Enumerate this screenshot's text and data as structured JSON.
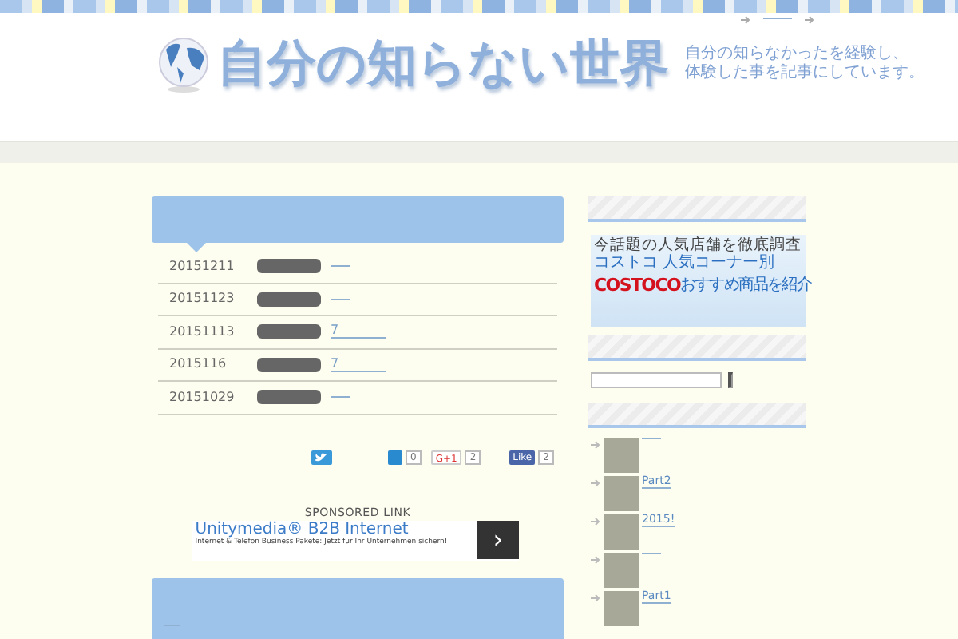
{
  "header": {
    "site_title": "自分の知らない世界",
    "tagline": [
      "自分の知らなかったを経験し、",
      "体験した事を記事にしています。"
    ]
  },
  "entries": [
    {
      "date": "20151211"
    },
    {
      "date": "20151123"
    },
    {
      "date": "20151113",
      "title": "7"
    },
    {
      "date": "2015116",
      "title": "7"
    },
    {
      "date": "20151029"
    }
  ],
  "share": {
    "hatena_count": "0",
    "gplus_label": "G+1",
    "gplus_count": "2",
    "fb_label": "Like",
    "fb_count": "2"
  },
  "sponsored": {
    "label": "SPONSORED LINK",
    "ad_title": "Unitymedia® B2B Internet",
    "ad_text": "Internet & Telefon Business Pakete: Jetzt für Ihr Unternehmen sichern!",
    "ad_next": "›"
  },
  "banner": {
    "small": "今話題の人気店舗を徹底調査",
    "heading": "コストコ 人気コーナー別",
    "brand": "COSTOCO",
    "sub": "おすすめ商品を紹介"
  },
  "sidebar_posts": [
    {
      "kind": "untitled"
    },
    {
      "kind": "titled",
      "title": "Part2"
    },
    {
      "kind": "titled",
      "title": "2015!"
    },
    {
      "kind": "untitled"
    },
    {
      "kind": "titled",
      "title": "Part1"
    }
  ]
}
